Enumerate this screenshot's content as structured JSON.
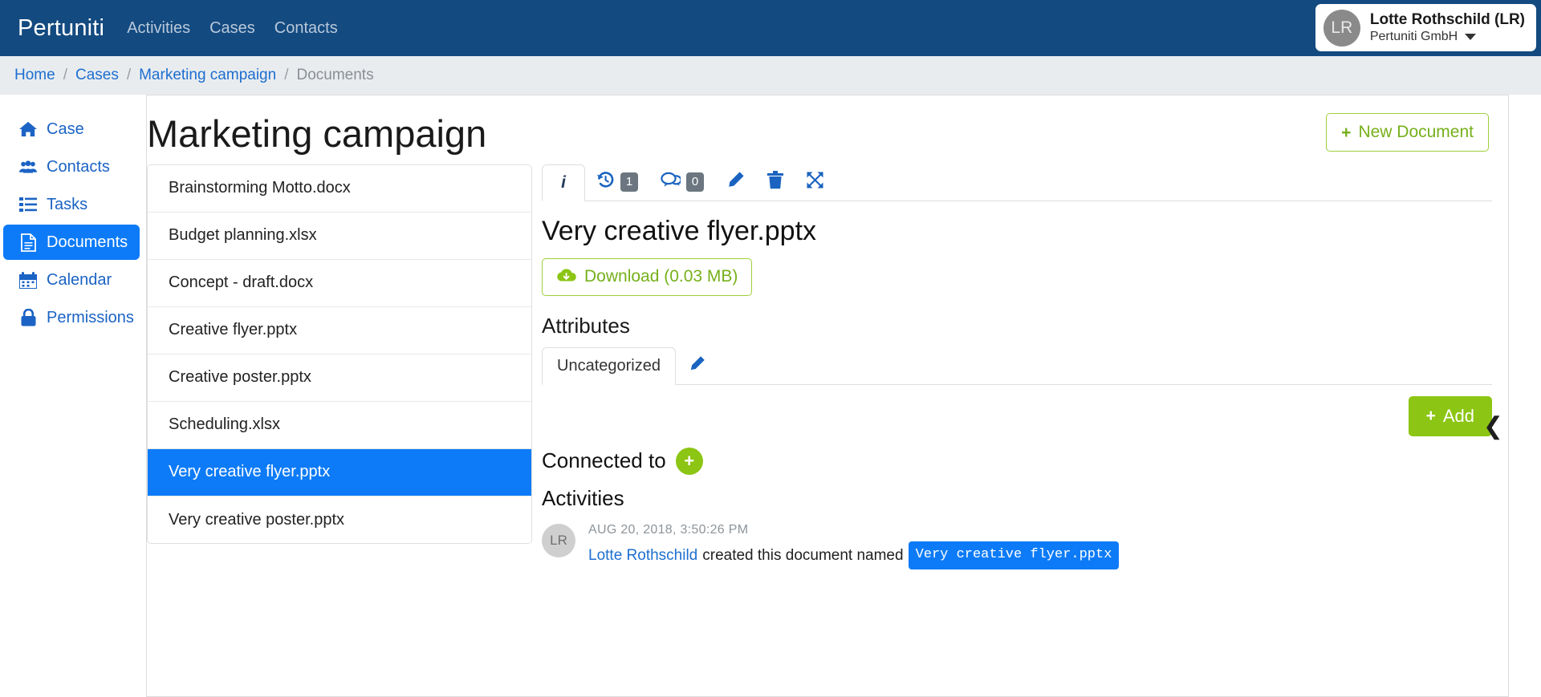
{
  "topnav": {
    "brand": "Pertuniti",
    "links": [
      {
        "label": "Activities"
      },
      {
        "label": "Cases"
      },
      {
        "label": "Contacts"
      }
    ],
    "user": {
      "initials": "LR",
      "name": "Lotte Rothschild (LR)",
      "org": "Pertuniti GmbH"
    }
  },
  "breadcrumb": {
    "items": [
      {
        "label": "Home",
        "current": false
      },
      {
        "label": "Cases",
        "current": false
      },
      {
        "label": "Marketing campaign",
        "current": false
      },
      {
        "label": "Documents",
        "current": true
      }
    ],
    "separator": "/"
  },
  "sidebar": {
    "items": [
      {
        "label": "Case",
        "icon": "home-icon",
        "active": false
      },
      {
        "label": "Contacts",
        "icon": "users-icon",
        "active": false
      },
      {
        "label": "Tasks",
        "icon": "list-icon",
        "active": false
      },
      {
        "label": "Documents",
        "icon": "document-icon",
        "active": true
      },
      {
        "label": "Calendar",
        "icon": "calendar-icon",
        "active": false
      },
      {
        "label": "Permissions",
        "icon": "lock-icon",
        "active": false
      }
    ]
  },
  "page": {
    "title": "Marketing campaign",
    "new_document_label": "New Document",
    "plus": "+"
  },
  "documents": {
    "items": [
      {
        "name": "Brainstorming Motto.docx",
        "selected": false
      },
      {
        "name": "Budget planning.xlsx",
        "selected": false
      },
      {
        "name": "Concept - draft.docx",
        "selected": false
      },
      {
        "name": "Creative flyer.pptx",
        "selected": false
      },
      {
        "name": "Creative poster.pptx",
        "selected": false
      },
      {
        "name": "Scheduling.xlsx",
        "selected": false
      },
      {
        "name": "Very creative flyer.pptx",
        "selected": true
      },
      {
        "name": "Very creative poster.pptx",
        "selected": false
      }
    ]
  },
  "detail": {
    "toolbar": {
      "info_tab_label": "i",
      "history_badge": "1",
      "comments_badge": "0"
    },
    "document_name": "Very creative flyer.pptx",
    "download_label": "Download (0.03 MB)",
    "attributes_heading": "Attributes",
    "attribute_tab_label": "Uncategorized",
    "add_label": "Add",
    "add_plus": "+",
    "connected_to_label": "Connected to",
    "connected_plus": "+",
    "activities_heading": "Activities",
    "feed": [
      {
        "avatar_initials": "LR",
        "timestamp": "AUG 20, 2018, 3:50:26 PM",
        "user": "Lotte Rothschild",
        "text": "created this document named",
        "chip": "Very creative flyer.pptx"
      }
    ]
  },
  "colors": {
    "navy": "#134a80",
    "accent_blue": "#0d7bf7",
    "link_blue": "#1d6fd0",
    "green": "#8cc513",
    "green_outline": "#76b01a",
    "badge_gray": "#6b7680"
  }
}
